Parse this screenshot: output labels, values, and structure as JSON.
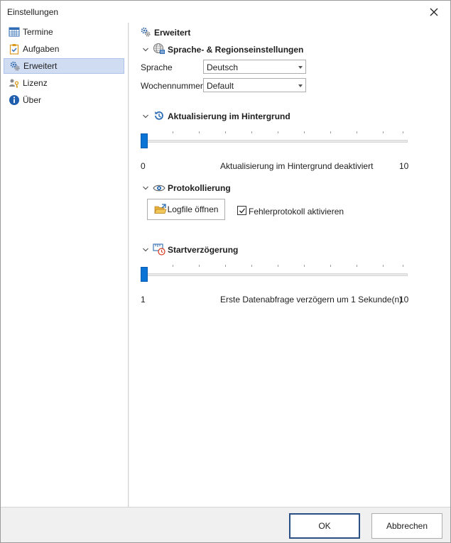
{
  "window": {
    "title": "Einstellungen"
  },
  "sidebar": {
    "items": [
      {
        "label": "Termine",
        "icon": "calendar-grid-icon"
      },
      {
        "label": "Aufgaben",
        "icon": "clipboard-check-icon"
      },
      {
        "label": "Erweitert",
        "icon": "gears-icon",
        "selected": true
      },
      {
        "label": "Lizenz",
        "icon": "users-key-icon"
      },
      {
        "label": "Über",
        "icon": "info-icon"
      }
    ]
  },
  "main": {
    "header": "Erweitert",
    "sections": {
      "language": {
        "title": "Sprache- & Regionseinstellungen",
        "sprache_label": "Sprache",
        "sprache_value": "Deutsch",
        "woche_label": "Wochennummer",
        "woche_value": "Default"
      },
      "background": {
        "title": "Aktualisierung im Hintergrund",
        "slider_min": "0",
        "slider_max": "10",
        "slider_value": 0,
        "status": "Aktualisierung im Hintergrund deaktiviert"
      },
      "logging": {
        "title": "Protokollierung",
        "open_button": "Logfile öffnen",
        "checkbox_label": "Fehlerprotokoll aktivieren",
        "checkbox_checked": true
      },
      "startup": {
        "title": "Startverzögerung",
        "slider_min": "1",
        "slider_max": "10",
        "slider_value": 1,
        "status": "Erste Datenabfrage verzögern um 1 Sekunde(n)"
      }
    }
  },
  "footer": {
    "ok": "OK",
    "cancel": "Abbrechen"
  },
  "colors": {
    "accent": "#0a74d6",
    "selection": "#cfdcf2",
    "focus_border": "#2a4f84"
  }
}
